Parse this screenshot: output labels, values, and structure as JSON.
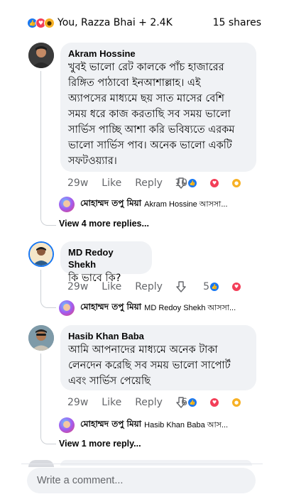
{
  "reactions_bar": {
    "icons": [
      "like-icon",
      "love-icon",
      "wow-icon"
    ],
    "summary": "You, Razza Bhai + 2.4K",
    "shares": "15 shares"
  },
  "comments": [
    {
      "author": "Akram Hossine",
      "lines": [
        "খুবই ভালো রেট কালকে পাঁচ হাজারের",
        "রিঙ্গিত পাঠাবো ইনআশাল্লাহ। এই",
        "অ্যাপসের মাধ্যমে ছয় সাত মাসের বেশি",
        "সময় ধরে কাজ করতাছি সব সময় ভালো",
        "সার্ভিস পাচ্ছি আশা করি ভবিষ্যতে এরকম",
        "ভালো সার্ভিস পাব। অনেক ভালো একটি",
        "সফটওয়্যার।"
      ],
      "time": "29w",
      "like": "Like",
      "reply": "Reply",
      "reaction_count": "10",
      "reaction_icons": [
        "like-icon",
        "love-icon",
        "care-icon"
      ],
      "reply_preview": {
        "name": "মোহাম্মদ তপু মিয়া",
        "snippet": "Akram Hossine আসসা..."
      },
      "view_more": "View 4 more replies..."
    },
    {
      "author": "MD Redoy Shekh",
      "lines": [
        "কি ভাবে কি?"
      ],
      "time": "29w",
      "like": "Like",
      "reply": "Reply",
      "reaction_count": "5",
      "reaction_icons": [
        "like-icon",
        "love-icon"
      ],
      "reply_preview": {
        "name": "মোহাম্মদ তপু মিয়া",
        "snippet": "MD Redoy Shekh আসসা..."
      }
    },
    {
      "author": "Hasib Khan Baba",
      "lines": [
        "আমি আপনাদের মাধ্যমে অনেক টাকা",
        "লেনদেন করেছি সব সময় ভালো সাপোর্ট",
        "এবং সার্ভিস পেয়েছি"
      ],
      "time": "29w",
      "like": "Like",
      "reply": "Reply",
      "reaction_count": "6",
      "reaction_icons": [
        "like-icon",
        "love-icon",
        "care-icon"
      ],
      "reply_preview": {
        "name": "মোহাম্মদ তপু মিয়া",
        "snippet": "Hasib Khan Baba আস..."
      },
      "view_more": "View 1 more reply..."
    }
  ],
  "composer": {
    "placeholder": "Write a comment..."
  },
  "colors": {
    "like": "#1877f2",
    "love": "#f33e58",
    "wow": "#f7b125",
    "bubble": "#f0f2f5",
    "muted": "#65676b"
  }
}
